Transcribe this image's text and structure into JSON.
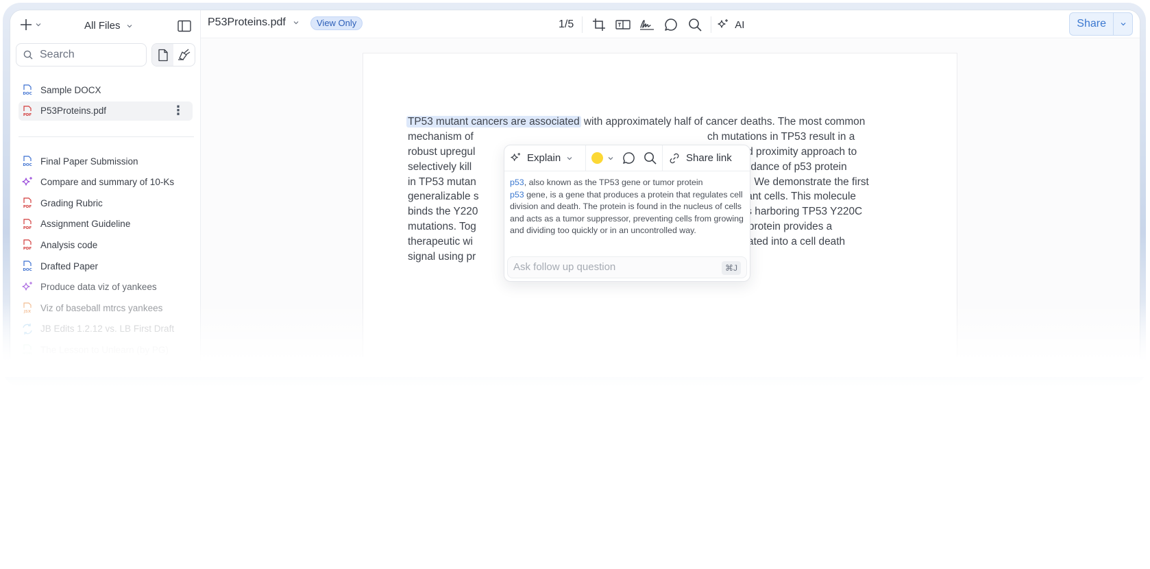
{
  "sidebar": {
    "new_label": "+",
    "all_files_label": "All Files",
    "search_placeholder": "Search",
    "pinned": [
      {
        "name": "Sample DOCX",
        "type": "doc"
      },
      {
        "name": "P53Proteins.pdf",
        "type": "pdf",
        "active": true
      }
    ],
    "recent": [
      {
        "name": "Final Paper Submission",
        "type": "doc"
      },
      {
        "name": "Compare and summary of 10-Ks",
        "type": "ai"
      },
      {
        "name": "Grading Rubric",
        "type": "pdf"
      },
      {
        "name": "Assignment Guideline",
        "type": "pdf"
      },
      {
        "name": "Analysis code",
        "type": "pdf"
      },
      {
        "name": "Drafted Paper",
        "type": "doc"
      },
      {
        "name": "Produce data viz of yankees",
        "type": "ai"
      },
      {
        "name": "Viz of baseball mtrcs yankees",
        "type": "jsx"
      },
      {
        "name": "JB Edits 1.2.12 vs. LB First Draft",
        "type": "diff"
      },
      {
        "name": "The Lesson to Unlearn (by PG)",
        "type": "html"
      }
    ]
  },
  "header": {
    "doc_title": "P53Proteins.pdf",
    "badge": "View Only",
    "page_indicator": "1/5",
    "ai_label": "AI",
    "share_label": "Share"
  },
  "document": {
    "highlighted": "TP53 mutant cancers are associated",
    "lines": [
      " with approximately half of cancer deaths. The most common",
      "mechanism of",
      "robust upregul",
      "selectively kill",
      "in TP53 mutan",
      "generalizable s",
      "binds the Y220",
      "mutations. Tog",
      "therapeutic wi",
      "signal using pr"
    ],
    "right_fragments": [
      "ch mutations in TP53 result in a",
      "n induced proximity approach to",
      "sed abundance of p53 protein",
      "ese cells. We demonstrate the first",
      "P53 mutant cells. This molecule",
      "or in cells harboring TP53 Y220C",
      "e of p53 protein provides a",
      "be translated into a cell death"
    ]
  },
  "popover": {
    "explain_label": "Explain",
    "highlight_color": "#fcd835",
    "share_link_label": "Share link",
    "explanation": {
      "link1": "p53",
      "part1": ", also known as the TP53 gene or tumor protein",
      "link2": "p53",
      "part2": " gene, is a gene that produces a protein that regulates cell division and death. The protein is found in the nucleus of cells and acts as a tumor suppressor, preventing cells from growing and dividing too quickly or in an uncontrolled way."
    },
    "followup_placeholder": "Ask follow up question",
    "shortcut": "⌘J"
  }
}
